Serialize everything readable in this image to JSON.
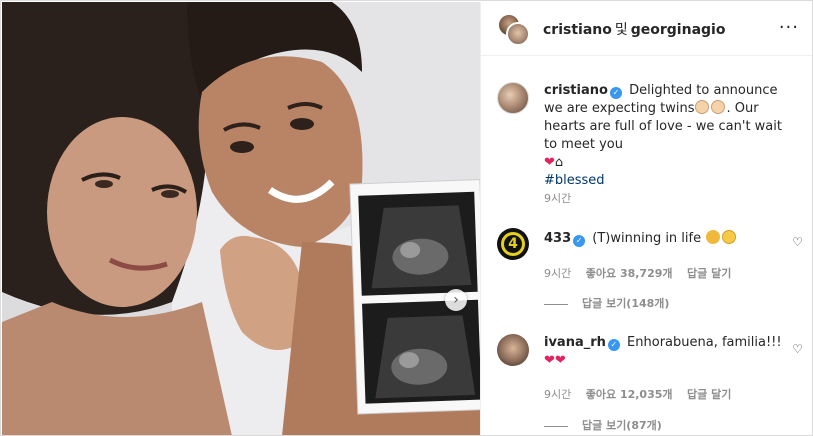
{
  "header": {
    "user1": "cristiano",
    "conjunction": "및",
    "user2": "georginagio",
    "more_icon": "ellipsis-icon"
  },
  "caption": {
    "username": "cristiano",
    "verified": true,
    "text_part1": "Delighted to announce we are expecting twins",
    "text_part2": ". Our hearts are full of love - we can't wait to meet you",
    "hashtag": "#blessed",
    "time": "9시간"
  },
  "comments": [
    {
      "username": "433",
      "verified": true,
      "text": "(T)winning in life",
      "time": "9시간",
      "likes": "좋아요 38,729개",
      "reply": "답글 달기",
      "view_replies": "답글 보기(148개)"
    },
    {
      "username": "ivana_rh",
      "verified": true,
      "text": "Enhorabuena, familia!!!",
      "time": "9시간",
      "likes": "좋아요 12,035개",
      "reply": "답글 달기",
      "view_replies": "답글 보기(87개)"
    }
  ],
  "colors": {
    "verified_badge": "#3897f0",
    "hashtag": "#00376b",
    "muted_text": "#8e8e8e",
    "heart": "#e0245e"
  }
}
